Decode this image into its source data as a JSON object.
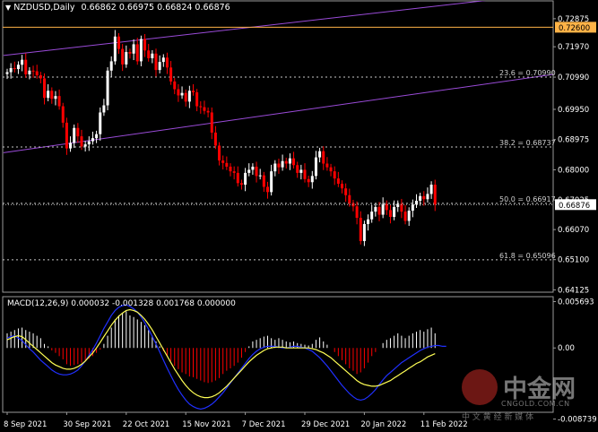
{
  "header": {
    "symbol": "NZDUSD,Daily",
    "ohlc": "0.66862 0.66975 0.66824 0.66876"
  },
  "colors": {
    "bull": "#ffffff",
    "bear": "#ff0000",
    "channel": "#9a4bd8",
    "hline": "#ffb347",
    "fib": "#c8c8c8",
    "macd_hist_pos": "#ffffff",
    "macd_hist_neg": "#ff0000",
    "macd_signal": "#ffff55",
    "macd_line": "#2030ff",
    "current_price_tag": "#ffffff",
    "hline_tag": "#ffb347"
  },
  "watermark": {
    "brand": "中金网",
    "subtitle": "中 文 黄 经 新 媒 体",
    "site": "CNGOLD.COM.CN"
  },
  "chart_data": [
    {
      "type": "candlestick",
      "title": "NZDUSD,Daily",
      "ylim": [
        0.6405,
        0.7345
      ],
      "price_axis_ticks": [
        "0.73865",
        "0.72875",
        "0.71970",
        "0.70990",
        "0.69950",
        "0.68975",
        "0.68000",
        "0.67025",
        "0.66070",
        "0.65100",
        "0.64125"
      ],
      "price_axis_values": [
        0.73865,
        0.72875,
        0.7197,
        0.7099,
        0.6995,
        0.68975,
        0.68,
        0.67025,
        0.6607,
        0.651,
        0.64125
      ],
      "current_price": "0.66876",
      "current_price_value": 0.66876,
      "hline_label": "0.72600",
      "hline_value": 0.726,
      "x_labels": [
        "8 Sep 2021",
        "30 Sep 2021",
        "22 Oct 2021",
        "15 Nov 2021",
        "7 Dec 2021",
        "29 Dec 2021",
        "20 Jan 2022",
        "11 Feb 2022"
      ],
      "x_label_bars": [
        0,
        16,
        32,
        48,
        64,
        80,
        96,
        112
      ],
      "fib_levels": [
        {
          "label": "23.6 = 0.70990",
          "value": 0.7099
        },
        {
          "label": "38.2 = 0.68737",
          "value": 0.68737
        },
        {
          "label": "50.0 = 0.66917",
          "value": 0.66917
        },
        {
          "label": "61.8 = 0.65096",
          "value": 0.65096
        }
      ],
      "channel_lines": [
        {
          "from": [
            -1,
            0.7169
          ],
          "to": [
            135,
            0.7355
          ]
        },
        {
          "from": [
            -1,
            0.6855
          ],
          "to": [
            151,
            0.7115
          ]
        }
      ],
      "closes": [
        0.7115,
        0.7128,
        0.7125,
        0.7139,
        0.7155,
        0.7108,
        0.712,
        0.7118,
        0.7105,
        0.7095,
        0.7032,
        0.7055,
        0.7029,
        0.7038,
        0.7005,
        0.6952,
        0.6869,
        0.6887,
        0.6935,
        0.6908,
        0.6875,
        0.6882,
        0.6892,
        0.6902,
        0.6915,
        0.6985,
        0.7008,
        0.712,
        0.715,
        0.723,
        0.719,
        0.714,
        0.718,
        0.7175,
        0.7205,
        0.715,
        0.7222,
        0.7185,
        0.716,
        0.7175,
        0.7122,
        0.7148,
        0.7162,
        0.713,
        0.7085,
        0.706,
        0.704,
        0.7048,
        0.702,
        0.7055,
        0.705,
        0.7005,
        0.7002,
        0.699,
        0.6985,
        0.692,
        0.6878,
        0.683,
        0.6822,
        0.681,
        0.6795,
        0.679,
        0.6757,
        0.6752,
        0.679,
        0.68,
        0.681,
        0.678,
        0.6782,
        0.6745,
        0.6728,
        0.6795,
        0.682,
        0.6808,
        0.6828,
        0.682,
        0.6837,
        0.6815,
        0.679,
        0.68,
        0.677,
        0.676,
        0.678,
        0.684,
        0.686,
        0.682,
        0.6808,
        0.6795,
        0.6772,
        0.6755,
        0.674,
        0.6718,
        0.6692,
        0.6682,
        0.6645,
        0.657,
        0.6625,
        0.664,
        0.6665,
        0.668,
        0.6655,
        0.669,
        0.667,
        0.6648,
        0.668,
        0.669,
        0.6665,
        0.6635,
        0.6668,
        0.6688,
        0.67,
        0.6715,
        0.6705,
        0.6722,
        0.6752,
        0.6688
      ],
      "macd": {
        "label": "MACD(12,26,9) 0.000032 -0.001328 0.001768 0.000000",
        "ylim": [
          -0.0079,
          0.0063
        ],
        "ticks": [
          "0.005693",
          "0.00",
          "-0.008739"
        ],
        "tick_values": [
          0.005693,
          0.0,
          -0.008739
        ],
        "histogram": [
          0.0018,
          0.002,
          0.0022,
          0.0024,
          0.0025,
          0.0022,
          0.002,
          0.0018,
          0.0015,
          0.0012,
          0.0005,
          0.0002,
          -0.0003,
          -0.0006,
          -0.001,
          -0.0014,
          -0.002,
          -0.0022,
          -0.0021,
          -0.002,
          -0.0018,
          -0.0016,
          -0.0013,
          -0.001,
          -0.0006,
          -0.0002,
          0.0005,
          0.0015,
          0.0025,
          0.0035,
          0.004,
          0.0043,
          0.0045,
          0.004,
          0.0038,
          0.0035,
          0.0032,
          0.0028,
          0.0022,
          0.0015,
          0.0008,
          0.0002,
          -0.0004,
          -0.001,
          -0.0016,
          -0.0022,
          -0.0026,
          -0.003,
          -0.0032,
          -0.0035,
          -0.0036,
          -0.0038,
          -0.004,
          -0.0042,
          -0.0043,
          -0.0042,
          -0.004,
          -0.0037,
          -0.0032,
          -0.0028,
          -0.0025,
          -0.0022,
          -0.0018,
          -0.0012,
          -0.0005,
          0.0002,
          0.0008,
          0.001,
          0.0012,
          0.0014,
          0.0015,
          0.0012,
          0.001,
          0.0012,
          0.001,
          0.0008,
          0.0007,
          0.0008,
          0.0006,
          0.0005,
          0.0004,
          0.0003,
          0.0005,
          0.001,
          0.0013,
          0.0008,
          0.0004,
          0.0,
          -0.0005,
          -0.001,
          -0.0015,
          -0.002,
          -0.0025,
          -0.0028,
          -0.0032,
          -0.003,
          -0.0025,
          -0.0018,
          -0.001,
          -0.0005,
          0.0,
          0.0006,
          0.001,
          0.0012,
          0.0015,
          0.0018,
          0.0015,
          0.0012,
          0.0015,
          0.0018,
          0.002,
          0.0022,
          0.002,
          0.0023,
          0.0025,
          0.0018
        ],
        "signal": [
          0.001,
          0.0012,
          0.0014,
          0.0015,
          0.0014,
          0.001,
          0.0006,
          0.0002,
          -0.0002,
          -0.0006,
          -0.001,
          -0.0014,
          -0.0018,
          -0.0021,
          -0.0023,
          -0.0025,
          -0.0026,
          -0.0026,
          -0.0025,
          -0.0023,
          -0.002,
          -0.0016,
          -0.0011,
          -0.0006,
          0.0,
          0.0007,
          0.0014,
          0.0021,
          0.0028,
          0.0034,
          0.0039,
          0.0043,
          0.0046,
          0.0047,
          0.0046,
          0.0044,
          0.004,
          0.0035,
          0.0029,
          0.0022,
          0.0014,
          0.0006,
          -0.0002,
          -0.001,
          -0.0018,
          -0.0026,
          -0.0033,
          -0.004,
          -0.0046,
          -0.0051,
          -0.0055,
          -0.0058,
          -0.006,
          -0.0061,
          -0.0061,
          -0.006,
          -0.0058,
          -0.0055,
          -0.0051,
          -0.0047,
          -0.0042,
          -0.0037,
          -0.0032,
          -0.0027,
          -0.0022,
          -0.0017,
          -0.0013,
          -0.0009,
          -0.0006,
          -0.0003,
          -0.0001,
          0.0,
          0.0001,
          0.0001,
          0.0001,
          0.0,
          0.0,
          0.0,
          0.0,
          0.0,
          0.0,
          0.0,
          -0.0001,
          -0.0002,
          -0.0004,
          -0.0006,
          -0.0009,
          -0.0012,
          -0.0016,
          -0.002,
          -0.0024,
          -0.0028,
          -0.0032,
          -0.0036,
          -0.004,
          -0.0043,
          -0.0045,
          -0.0046,
          -0.0047,
          -0.0047,
          -0.0046,
          -0.0044,
          -0.0042,
          -0.004,
          -0.0037,
          -0.0034,
          -0.0031,
          -0.0028,
          -0.0025,
          -0.0022,
          -0.0019,
          -0.0017,
          -0.0014,
          -0.0011,
          -0.0009,
          -0.0007
        ],
        "macd_line": [
          0.0012,
          0.0014,
          0.0015,
          0.0012,
          0.0009,
          0.0004,
          -0.0001,
          -0.0005,
          -0.001,
          -0.0015,
          -0.0019,
          -0.0023,
          -0.0027,
          -0.003,
          -0.0032,
          -0.0033,
          -0.0033,
          -0.0032,
          -0.003,
          -0.0027,
          -0.0022,
          -0.0016,
          -0.0009,
          -0.0002,
          0.0006,
          0.0015,
          0.0024,
          0.0032,
          0.004,
          0.0046,
          0.005,
          0.0052,
          0.0053,
          0.0051,
          0.0048,
          0.0044,
          0.0038,
          0.0031,
          0.0023,
          0.0014,
          0.0005,
          -0.0005,
          -0.0015,
          -0.0025,
          -0.0034,
          -0.0043,
          -0.0051,
          -0.0058,
          -0.0064,
          -0.0069,
          -0.0072,
          -0.0074,
          -0.0075,
          -0.0074,
          -0.0072,
          -0.0069,
          -0.0065,
          -0.006,
          -0.0055,
          -0.0049,
          -0.0043,
          -0.0037,
          -0.0031,
          -0.0025,
          -0.0019,
          -0.0013,
          -0.0008,
          -0.0004,
          -0.0001,
          0.0001,
          0.0002,
          0.0002,
          0.0002,
          0.0001,
          0.0,
          0.0,
          0.0001,
          0.0002,
          0.0002,
          0.0001,
          0.0,
          -0.0002,
          -0.0004,
          -0.0008,
          -0.0012,
          -0.0017,
          -0.0022,
          -0.0028,
          -0.0034,
          -0.004,
          -0.0046,
          -0.0051,
          -0.0056,
          -0.006,
          -0.0063,
          -0.0064,
          -0.0063,
          -0.006,
          -0.0056,
          -0.0051,
          -0.0045,
          -0.0039,
          -0.0034,
          -0.003,
          -0.0026,
          -0.0022,
          -0.0018,
          -0.0015,
          -0.0012,
          -0.0009,
          -0.0006,
          -0.0003,
          -0.0001,
          0.0001,
          0.0002,
          0.0003,
          0.0003,
          0.0002,
          0.0002
        ]
      }
    }
  ]
}
